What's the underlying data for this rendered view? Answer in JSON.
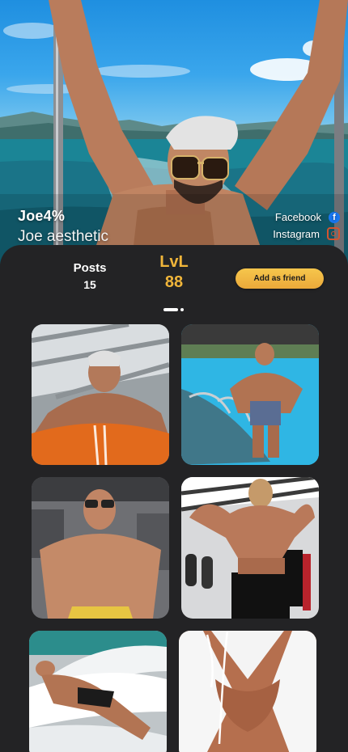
{
  "profile": {
    "username": "Joe4%",
    "display_name": "Joe aesthetic",
    "hero_photo": "shirtless man in sunglasses on boat, sea and mountains behind"
  },
  "social": {
    "facebook": {
      "label": "Facebook",
      "icon": "facebook-icon",
      "color": "#1877f2"
    },
    "instagram": {
      "label": "Instagram",
      "icon": "instagram-icon",
      "color": "#d3542f"
    }
  },
  "stats": {
    "posts_label": "Posts",
    "posts_value": "15",
    "level_label": "LvL",
    "level_value": "88"
  },
  "actions": {
    "add_friend_label": "Add as friend"
  },
  "pager": {
    "pages": 2,
    "current": 1
  },
  "gallery": [
    {
      "description": "low-angle gym selfie, orange shorts"
    },
    {
      "description": "man standing on pool ladder"
    },
    {
      "description": "gym front pose with glasses"
    },
    {
      "description": "back double biceps pose"
    },
    {
      "description": "man lying on white pool lounger"
    },
    {
      "description": "close-up of chest with earphones"
    }
  ],
  "colors": {
    "accent": "#f0b53a",
    "panel": "#232325",
    "background": "#1f1f21"
  }
}
